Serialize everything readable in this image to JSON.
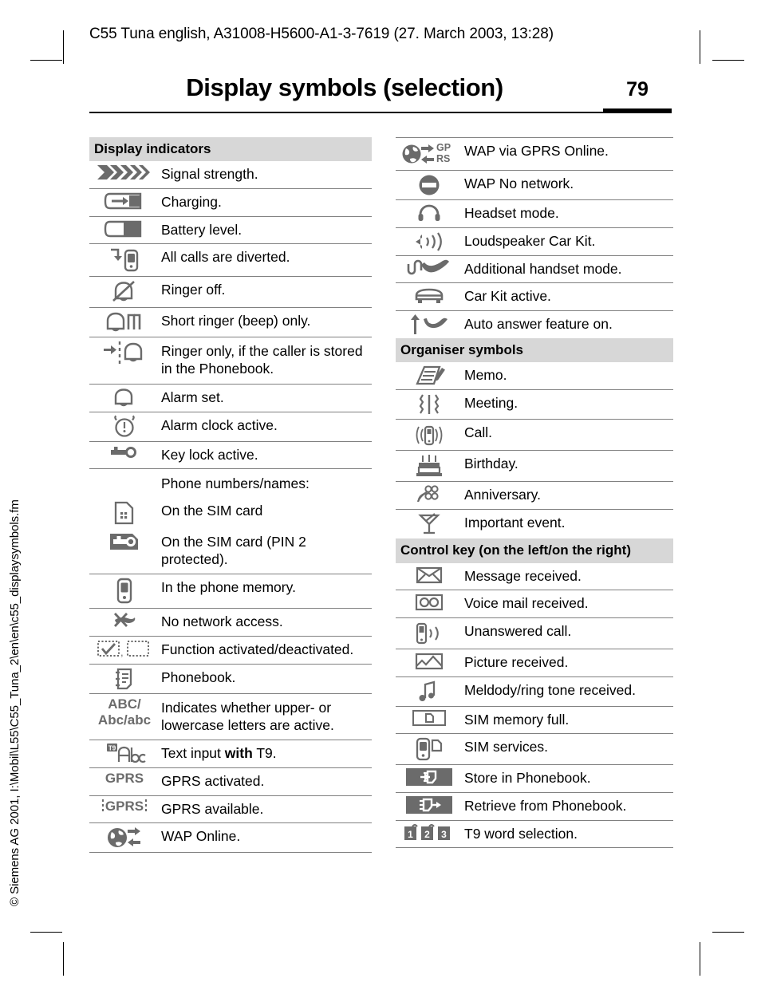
{
  "header": {
    "doc_line": "C55 Tuna english, A31008-H5600-A1-3-7619 (27. March 2003, 13:28)",
    "title": "Display symbols (selection)",
    "page_number": "79"
  },
  "side_caption": "© Siemens AG 2001, I:\\Mobil\\L55\\C55_Tuna_2\\en\\en\\c55_displaysymbols.fm",
  "colors": {
    "band_gray": "#d7d7d7",
    "icon_gray": "#6b6b6b",
    "rule_gray": "#808080"
  },
  "left_column": {
    "band": "Display indicators",
    "rows": [
      {
        "icon": "signal-strength-icon",
        "text": "Signal strength."
      },
      {
        "icon": "battery-charging-icon",
        "text": "Charging."
      },
      {
        "icon": "battery-level-icon",
        "text": "Battery level."
      },
      {
        "icon": "call-divert-icon",
        "text": "All calls are diverted."
      },
      {
        "icon": "ringer-off-icon",
        "text": "Ringer off."
      },
      {
        "icon": "short-ringer-beep-icon",
        "text": "Short ringer (beep) only."
      },
      {
        "icon": "ringer-phonebook-only-icon",
        "text": "Ringer only, if the caller is stored in the Phonebook."
      },
      {
        "icon": "alarm-set-icon",
        "text": "Alarm set."
      },
      {
        "icon": "alarm-clock-active-icon",
        "text": "Alarm clock active."
      },
      {
        "icon": "key-lock-icon",
        "text": "Key lock active."
      },
      {
        "icon": "none",
        "text": "Phone numbers/names:"
      },
      {
        "icon": "sim-card-icon",
        "text": "On the SIM card"
      },
      {
        "icon": "sim-card-pin2-icon",
        "text": "On the SIM card (PIN 2 protected)."
      },
      {
        "icon": "phone-memory-icon",
        "text": "In the phone memory."
      },
      {
        "icon": "no-network-icon",
        "text": "No network access."
      },
      {
        "icon": "function-toggle-icon",
        "text": "Function activated/deactivated."
      },
      {
        "icon": "phonebook-icon",
        "text": "Phonebook."
      },
      {
        "icon": "abc-case-icon",
        "icon_label_1": "ABC/",
        "icon_label_2": "Abc/abc",
        "text": "Indicates whether upper- or lowercase letters are active."
      },
      {
        "icon": "t9-abc-icon",
        "text_pre": "Text input ",
        "text_bold": "with",
        "text_post": " T9."
      },
      {
        "icon": "gprs-activated-icon",
        "icon_label": "GPRS",
        "text": "GPRS activated."
      },
      {
        "icon": "gprs-available-icon",
        "icon_label": "GPRS",
        "text": "GPRS available."
      },
      {
        "icon": "wap-online-icon",
        "text": "WAP Online."
      }
    ]
  },
  "right_column": {
    "sections": [
      {
        "band": null,
        "rows": [
          {
            "icon": "wap-gprs-online-icon",
            "icon_label_1": "GP",
            "icon_label_2": "RS",
            "text": "WAP via GPRS Online."
          },
          {
            "icon": "wap-no-network-icon",
            "text": "WAP No network."
          },
          {
            "icon": "headset-icon",
            "text": "Headset mode."
          },
          {
            "icon": "loudspeaker-car-kit-icon",
            "text": "Loudspeaker Car Kit."
          },
          {
            "icon": "additional-handset-icon",
            "text": "Additional handset mode."
          },
          {
            "icon": "car-kit-icon",
            "text": "Car Kit active."
          },
          {
            "icon": "auto-answer-icon",
            "text": "Auto answer feature on."
          }
        ]
      },
      {
        "band": "Organiser symbols",
        "rows": [
          {
            "icon": "memo-icon",
            "text": "Memo."
          },
          {
            "icon": "meeting-icon",
            "text": "Meeting."
          },
          {
            "icon": "call-icon",
            "text": "Call."
          },
          {
            "icon": "birthday-cake-icon",
            "text": "Birthday."
          },
          {
            "icon": "anniversary-icon",
            "text": "Anniversary."
          },
          {
            "icon": "important-event-icon",
            "text": "Important event."
          }
        ]
      },
      {
        "band": "Control key (on the left/on the right)",
        "rows": [
          {
            "icon": "message-received-icon",
            "text": "Message received."
          },
          {
            "icon": "voice-mail-icon",
            "text": "Voice mail received."
          },
          {
            "icon": "unanswered-call-icon",
            "text": "Unanswered call."
          },
          {
            "icon": "picture-received-icon",
            "text": "Picture received."
          },
          {
            "icon": "melody-ringtone-icon",
            "text": "Meldody/ring tone received."
          },
          {
            "icon": "sim-memory-full-icon",
            "text": "SIM memory full."
          },
          {
            "icon": "sim-services-icon",
            "text": "SIM services."
          },
          {
            "icon": "store-phonebook-icon",
            "text": "Store in Phonebook."
          },
          {
            "icon": "retrieve-phonebook-icon",
            "text": "Retrieve from Phonebook."
          },
          {
            "icon": "t9-word-selection-icon",
            "icon_label_1": "1",
            "icon_label_2": "2",
            "icon_label_3": "3",
            "text": "T9 word selection."
          }
        ]
      }
    ]
  }
}
